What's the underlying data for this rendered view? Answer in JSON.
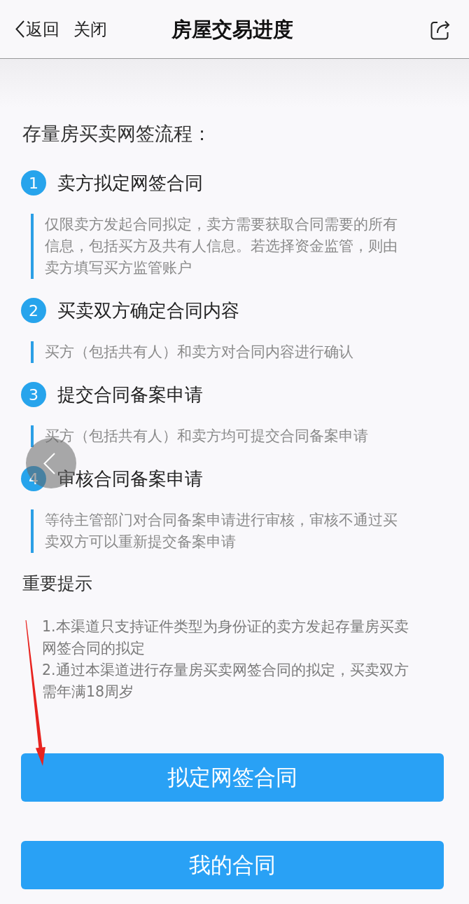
{
  "nav_bar": {
    "back": "返回",
    "close": "关闭",
    "title": "房屋交易进度"
  },
  "process": {
    "title": "存量房买卖网签流程：",
    "steps": [
      {
        "number": "1",
        "title": "卖方拟定网签合同",
        "description": "仅限卖方发起合同拟定，卖方需要获取合同需要的所有信息，包括买方及共有人信息。若选择资金监管，则由卖方填写买方监管账户"
      },
      {
        "number": "2",
        "title": "买卖双方确定合同内容",
        "description": "买方（包括共有人）和卖方对合同内容进行确认"
      },
      {
        "number": "3",
        "title": "提交合同备案申请",
        "description": "买方（包括共有人）和卖方均可提交合同备案申请"
      },
      {
        "number": "4",
        "title": "审核合同备案申请",
        "description": "等待主管部门对合同备案申请进行审核，审核不通过买卖双方可以重新提交备案申请"
      }
    ]
  },
  "notice": {
    "title": "重要提示",
    "items": [
      "1.本渠道只支持证件类型为身份证的卖方发起存量房买卖网签合同的拟定",
      "2.通过本渠道进行存量房买卖网签合同的拟定，买卖双方需年满18周岁"
    ]
  },
  "buttons": [
    "拟定网签合同",
    "我的合同"
  ]
}
